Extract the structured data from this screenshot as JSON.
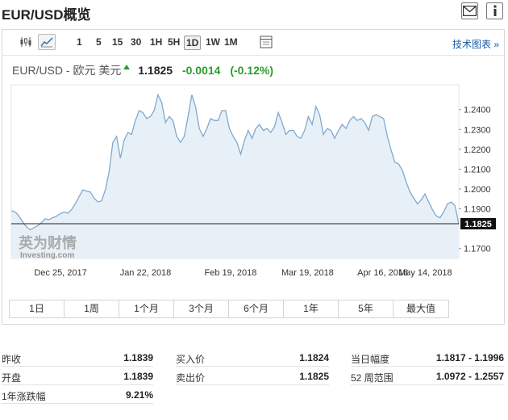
{
  "header": {
    "title": "EUR/USD概览",
    "icons": [
      "mail-icon",
      "info-icon"
    ]
  },
  "toolbar": {
    "chart_type_icons": [
      "candlestick-icon",
      "area-chart-icon"
    ],
    "timeframes": [
      "1",
      "5",
      "15",
      "30",
      "1H",
      "5H",
      "1D",
      "1W",
      "1M"
    ],
    "active_timeframe": "1D",
    "tech_link": "技术图表 »"
  },
  "quote": {
    "name": "EUR/USD - 欧元 美元",
    "price": "1.1825",
    "change": "-0.0014",
    "change_pct": "(-0.12%)"
  },
  "watermark": {
    "line1": "英为财情",
    "line2": "Investing.com"
  },
  "current_price_label": "1.1825",
  "chart_data": {
    "type": "area",
    "title": "",
    "xlabel": "",
    "ylabel": "",
    "x_tick_labels": [
      "Dec 25, 2017",
      "Jan 22, 2018",
      "Feb 19, 2018",
      "Mar 19, 2018",
      "Apr 16, 2018",
      "May 14, 2018"
    ],
    "y_tick_labels": [
      "1.2400",
      "1.2300",
      "1.2200",
      "1.2100",
      "1.2000",
      "1.1900",
      "1.1700"
    ],
    "ylim": [
      1.165,
      1.2525
    ],
    "current_value": 1.1825,
    "grid": false,
    "colors": {
      "line": "#7fa8cf",
      "fill": "#e8f0f7",
      "price_line": "#222222"
    },
    "series": [
      {
        "values": [
          1.189,
          1.1885,
          1.1865,
          1.1835,
          1.181,
          1.1795,
          1.1805,
          1.1815,
          1.183,
          1.185,
          1.1845,
          1.1855,
          1.1863,
          1.1875,
          1.1885,
          1.1878,
          1.1895,
          1.1925,
          1.196,
          1.1995,
          1.199,
          1.1985,
          1.1955,
          1.1935,
          1.194,
          1.1995,
          1.2085,
          1.2235,
          1.2265,
          1.2155,
          1.2245,
          1.2285,
          1.2275,
          1.2345,
          1.2395,
          1.2385,
          1.2355,
          1.2365,
          1.2395,
          1.2475,
          1.2435,
          1.2335,
          1.2365,
          1.2345,
          1.2265,
          1.2235,
          1.2265,
          1.2365,
          1.2475,
          1.2415,
          1.2305,
          1.2265,
          1.2305,
          1.2355,
          1.2345,
          1.2345,
          1.2395,
          1.2395,
          1.2305,
          1.2265,
          1.2235,
          1.2175,
          1.2245,
          1.2295,
          1.2255,
          1.2305,
          1.2325,
          1.2295,
          1.2305,
          1.2285,
          1.2315,
          1.2385,
          1.2335,
          1.2275,
          1.2295,
          1.2295,
          1.2265,
          1.2255,
          1.2295,
          1.2365,
          1.2325,
          1.2415,
          1.2375,
          1.2275,
          1.2305,
          1.2295,
          1.2255,
          1.2295,
          1.2325,
          1.2305,
          1.2345,
          1.2365,
          1.2345,
          1.2355,
          1.2335,
          1.2295,
          1.2365,
          1.2375,
          1.2365,
          1.2355,
          1.2265,
          1.2195,
          1.2135,
          1.2125,
          1.2095,
          1.2035,
          1.1985,
          1.1955,
          1.1925,
          1.1945,
          1.1975,
          1.1935,
          1.1895,
          1.1865,
          1.1855,
          1.1885,
          1.1925,
          1.1935,
          1.1915,
          1.1825
        ]
      }
    ]
  },
  "ranges": [
    "1日",
    "1周",
    "1个月",
    "3个月",
    "6个月",
    "1年",
    "5年",
    "最大值"
  ],
  "stats": {
    "col1": [
      {
        "label": "昨收",
        "value": "1.1839"
      },
      {
        "label": "开盘",
        "value": "1.1839"
      },
      {
        "label": "1年涨跌幅",
        "value": "9.21%"
      }
    ],
    "col2": [
      {
        "label": "买入价",
        "value": "1.1824"
      },
      {
        "label": "卖出价",
        "value": "1.1825"
      }
    ],
    "col3": [
      {
        "label": "当日幅度",
        "value": "1.1817 - 1.1996"
      },
      {
        "label": "52 周范围",
        "value": "1.0972 - 1.2557"
      }
    ]
  }
}
